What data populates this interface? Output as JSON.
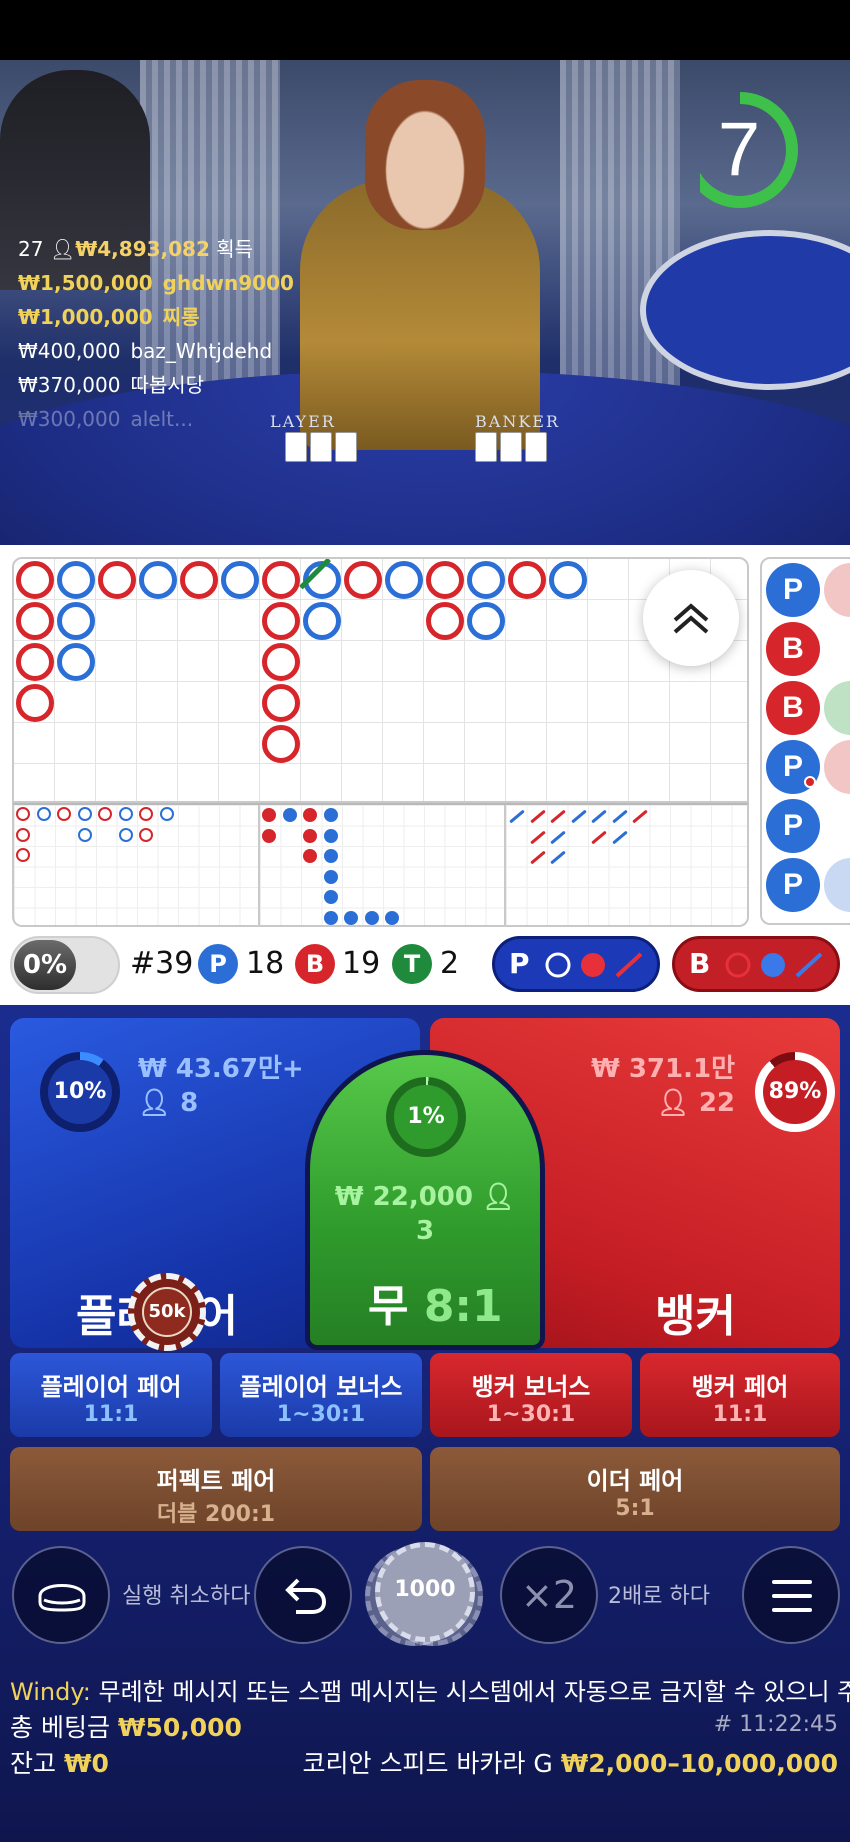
{
  "video": {
    "timer": "7",
    "timer_progress": 0.7,
    "felt_player": "LAYER",
    "felt_banker": "BANKER",
    "winners": {
      "count": "27",
      "total": "₩4,893,082",
      "suffix": "획득",
      "rows": [
        {
          "amount": "₩1,500,000",
          "name": "ghdwn9000"
        },
        {
          "amount": "₩1,000,000",
          "name": "찌롱"
        },
        {
          "amount": "₩400,000",
          "name": "baz_Whtjdehd"
        },
        {
          "amount": "₩370,000",
          "name": "따봅시당"
        },
        {
          "amount": "₩300,000",
          "name": "alelt..."
        }
      ]
    }
  },
  "roadmap": {
    "percent_toggle": "0%",
    "round": "#39",
    "player_label": "P",
    "player_count": "18",
    "banker_label": "B",
    "banker_count": "19",
    "tie_label": "T",
    "tie_count": "2",
    "predict_player": "P",
    "predict_banker": "B",
    "bead_labels": [
      "P",
      "B",
      "B",
      "P",
      "P",
      "P"
    ],
    "colors": {
      "player": "#2b6fd6",
      "banker": "#d6262b",
      "tie": "#1f8a3c"
    }
  },
  "bets": {
    "player": {
      "percent": "10%",
      "percent_value": 10,
      "amount": "₩ 43.67만+",
      "users": "8",
      "title": "플레이어"
    },
    "tie": {
      "percent": "1%",
      "percent_value": 1,
      "amount": "₩ 22,000",
      "users": "3",
      "title": "무",
      "odds": "8:1"
    },
    "banker": {
      "percent": "89%",
      "percent_value": 89,
      "amount": "₩ 371.1만",
      "users": "22",
      "title": "뱅커"
    },
    "chip_on_player": "50k",
    "side": [
      {
        "title": "플레이어 페어",
        "odds": "11:1"
      },
      {
        "title": "플레이어 보너스",
        "odds": "1~30:1"
      },
      {
        "title": "뱅커 보너스",
        "odds": "1~30:1"
      },
      {
        "title": "뱅커 페어",
        "odds": "11:1"
      }
    ],
    "perfect_pair": {
      "title": "퍼펙트 페어",
      "odds": "더블 200:1"
    },
    "either_pair": {
      "title": "이더 페어",
      "odds": "5:1"
    }
  },
  "controls": {
    "undo_label": "실행 취소하다",
    "chip_value": "1000",
    "double_symbol": "×2",
    "double_label": "2배로 하다"
  },
  "chat": {
    "user": "Windy:",
    "message": "무례한 메시지 또는 스팸 메시지는 시스템에서 자동으로 금지할 수 있으니 주의하세요"
  },
  "footer": {
    "total_bet_label": "총 베팅금",
    "total_bet_value": "₩50,000",
    "balance_label": "잔고",
    "balance_value": "₩0",
    "game_name": "코리안 스피드 바카라 G",
    "limits": "₩2,000–10,000,000",
    "time": "# 11:22:45"
  }
}
